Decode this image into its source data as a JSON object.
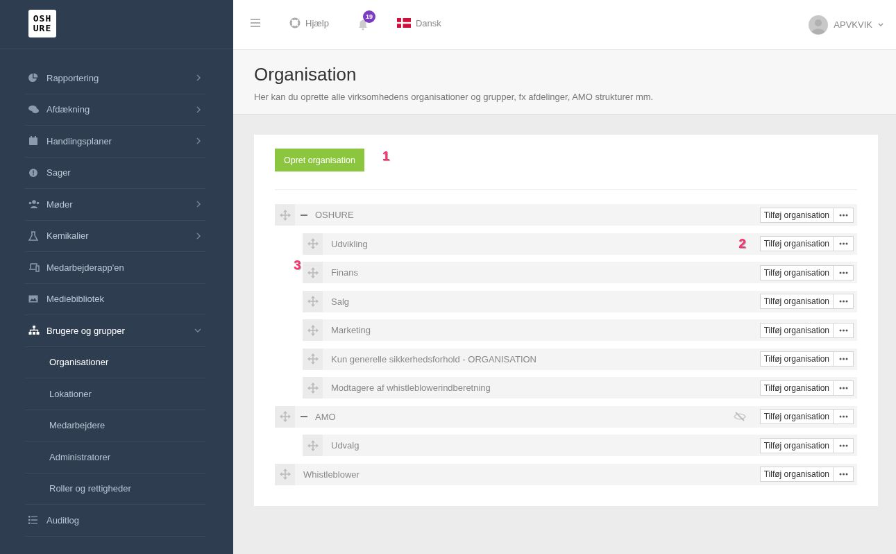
{
  "sidebar": {
    "logo": {
      "line_1": "OSH",
      "line_2": "URE"
    },
    "items": [
      {
        "kind": "pie",
        "label": "Rapportering",
        "submenu": true,
        "open": false,
        "selected": false
      },
      {
        "kind": "chat",
        "label": "Afdækning",
        "submenu": true,
        "open": false,
        "selected": false
      },
      {
        "kind": "calendar",
        "label": "Handlingsplaner",
        "submenu": true,
        "open": false,
        "selected": false
      },
      {
        "kind": "alert",
        "label": "Sager",
        "selected": false
      },
      {
        "kind": "people",
        "label": "Møder",
        "submenu": true,
        "open": false,
        "selected": false
      },
      {
        "kind": "flask",
        "label": "Kemikalier",
        "submenu": true,
        "open": false,
        "selected": false
      },
      {
        "kind": "devices",
        "label": "Medarbejderapp'en",
        "selected": false
      },
      {
        "kind": "image",
        "label": "Mediebibliotek",
        "selected": false
      },
      {
        "kind": "sitemap",
        "label": "Brugere og grupper",
        "submenu": true,
        "open": true,
        "selected": true,
        "children": [
          {
            "label": "Organisationer",
            "selected": true
          },
          {
            "label": "Lokationer",
            "selected": false
          },
          {
            "label": "Medarbejdere",
            "selected": false
          },
          {
            "label": "Administratorer",
            "selected": false
          },
          {
            "label": "Roller og rettigheder",
            "selected": false
          }
        ]
      },
      {
        "kind": "list",
        "label": "Auditlog",
        "selected": false
      }
    ]
  },
  "topbar": {
    "help": "Hjælp",
    "notifications": {
      "count": "19"
    },
    "language": "Dansk",
    "user": "APVKVIK"
  },
  "header": {
    "title": "Organisation",
    "subtitle": "Her kan du oprette alle virksomhedens organisationer og grupper, fx afdelinger, AMO strukturer mm."
  },
  "create_button": {
    "label": "Opret organisation",
    "marker": "1"
  },
  "tree": [
    {
      "label": "OSHURE",
      "expanded": true,
      "hidden": false,
      "action": "Tilføj organisation",
      "children": [
        {
          "label": "Udvikling",
          "hidden": false,
          "action": "Tilføj organisation",
          "marker": "2"
        },
        {
          "label": "Finans",
          "hidden": false,
          "action": "Tilføj organisation",
          "marker": "3"
        },
        {
          "label": "Salg",
          "hidden": false,
          "action": "Tilføj organisation"
        },
        {
          "label": "Marketing",
          "hidden": false,
          "action": "Tilføj organisation"
        },
        {
          "label": "Kun generelle sikkerhedsforhold - ORGANISATION",
          "hidden": false,
          "action": "Tilføj organisation"
        },
        {
          "label": "Modtagere af whistleblowerindberetning",
          "hidden": false,
          "action": "Tilføj organisation"
        }
      ]
    },
    {
      "label": "AMO",
      "expanded": true,
      "hidden": true,
      "action": "Tilføj organisation",
      "children": [
        {
          "label": "Udvalg",
          "hidden": false,
          "action": "Tilføj organisation"
        }
      ]
    },
    {
      "label": "Whistleblower",
      "hidden": false,
      "action": "Tilføj organisation"
    }
  ]
}
